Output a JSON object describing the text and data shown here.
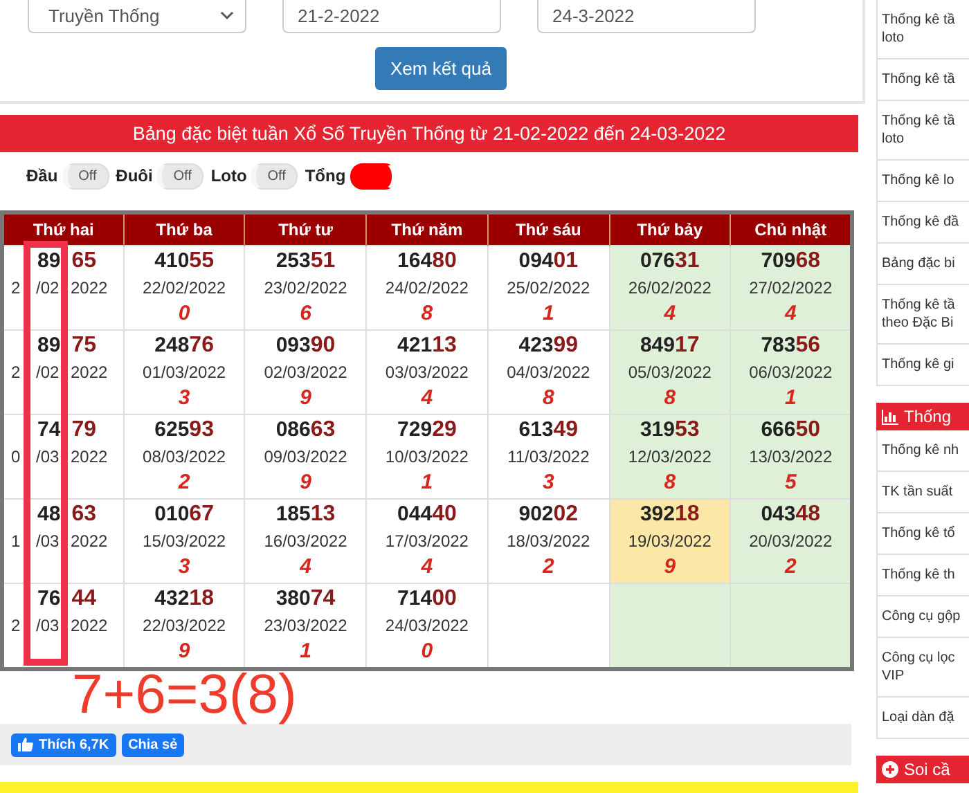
{
  "filter": {
    "province": "Truyền Thống",
    "from_date": "21-2-2022",
    "to_date": "24-3-2022",
    "submit": "Xem kết quả"
  },
  "banner": "Bảng đặc biệt tuần Xổ Số Truyền Thống từ 21-02-2022 đến 24-03-2022",
  "toggles": [
    {
      "label": "Đầu",
      "on": false,
      "state_text": "Off"
    },
    {
      "label": "Đuôi",
      "on": false,
      "state_text": "Off"
    },
    {
      "label": "Loto",
      "on": false,
      "state_text": "Off"
    },
    {
      "label": "Tổng",
      "on": true
    }
  ],
  "table": {
    "columns": [
      "Thứ hai",
      "Thứ ba",
      "Thứ tư",
      "Thứ năm",
      "Thứ sáu",
      "Thứ bảy",
      "Chủ nhật"
    ],
    "rows": [
      [
        {
          "kind": "covered",
          "head": "89",
          "tail": "65",
          "date_parts": [
            "2",
            "/02",
            "2022"
          ]
        },
        {
          "kind": "result",
          "head": "410",
          "tail": "55",
          "date": "22/02/2022",
          "sum": "0"
        },
        {
          "kind": "result",
          "head": "253",
          "tail": "51",
          "date": "23/02/2022",
          "sum": "6"
        },
        {
          "kind": "result",
          "head": "164",
          "tail": "80",
          "date": "24/02/2022",
          "sum": "8"
        },
        {
          "kind": "result",
          "head": "094",
          "tail": "01",
          "date": "25/02/2022",
          "sum": "1"
        },
        {
          "kind": "result",
          "head": "076",
          "tail": "31",
          "date": "26/02/2022",
          "sum": "4",
          "color": "#dff0d8"
        },
        {
          "kind": "result",
          "head": "709",
          "tail": "68",
          "date": "27/02/2022",
          "sum": "4",
          "color": "#dff0d8"
        }
      ],
      [
        {
          "kind": "covered",
          "head": "89",
          "tail": "75",
          "date_parts": [
            "2",
            "/02",
            "2022"
          ]
        },
        {
          "kind": "result",
          "head": "248",
          "tail": "76",
          "date": "01/03/2022",
          "sum": "3"
        },
        {
          "kind": "result",
          "head": "093",
          "tail": "90",
          "date": "02/03/2022",
          "sum": "9"
        },
        {
          "kind": "result",
          "head": "421",
          "tail": "13",
          "date": "03/03/2022",
          "sum": "4"
        },
        {
          "kind": "result",
          "head": "423",
          "tail": "99",
          "date": "04/03/2022",
          "sum": "8"
        },
        {
          "kind": "result",
          "head": "849",
          "tail": "17",
          "date": "05/03/2022",
          "sum": "8",
          "color": "#dff0d8"
        },
        {
          "kind": "result",
          "head": "783",
          "tail": "56",
          "date": "06/03/2022",
          "sum": "1",
          "color": "#dff0d8"
        }
      ],
      [
        {
          "kind": "covered",
          "head": "74",
          "tail": "79",
          "date_parts": [
            "0",
            "/03",
            "2022"
          ]
        },
        {
          "kind": "result",
          "head": "625",
          "tail": "93",
          "date": "08/03/2022",
          "sum": "2"
        },
        {
          "kind": "result",
          "head": "086",
          "tail": "63",
          "date": "09/03/2022",
          "sum": "9"
        },
        {
          "kind": "result",
          "head": "729",
          "tail": "29",
          "date": "10/03/2022",
          "sum": "1"
        },
        {
          "kind": "result",
          "head": "613",
          "tail": "49",
          "date": "11/03/2022",
          "sum": "3"
        },
        {
          "kind": "result",
          "head": "319",
          "tail": "53",
          "date": "12/03/2022",
          "sum": "8",
          "color": "#dff0d8"
        },
        {
          "kind": "result",
          "head": "666",
          "tail": "50",
          "date": "13/03/2022",
          "sum": "5",
          "color": "#dff0d8"
        }
      ],
      [
        {
          "kind": "covered",
          "head": "48",
          "tail": "63",
          "date_parts": [
            "1",
            "/03",
            "2022"
          ]
        },
        {
          "kind": "result",
          "head": "010",
          "tail": "67",
          "date": "15/03/2022",
          "sum": "3"
        },
        {
          "kind": "result",
          "head": "185",
          "tail": "13",
          "date": "16/03/2022",
          "sum": "4"
        },
        {
          "kind": "result",
          "head": "044",
          "tail": "40",
          "date": "17/03/2022",
          "sum": "4"
        },
        {
          "kind": "result",
          "head": "902",
          "tail": "02",
          "date": "18/03/2022",
          "sum": "2"
        },
        {
          "kind": "result",
          "head": "392",
          "tail": "18",
          "date": "19/03/2022",
          "sum": "9",
          "color": "#fce8a6"
        },
        {
          "kind": "result",
          "head": "043",
          "tail": "48",
          "date": "20/03/2022",
          "sum": "2",
          "color": "#dff0d8"
        }
      ],
      [
        {
          "kind": "covered",
          "head": "76",
          "tail": "44",
          "date_parts": [
            "2",
            "/03",
            "2022"
          ]
        },
        {
          "kind": "result",
          "head": "432",
          "tail": "18",
          "date": "22/03/2022",
          "sum": "9"
        },
        {
          "kind": "result",
          "head": "380",
          "tail": "74",
          "date": "23/03/2022",
          "sum": "1"
        },
        {
          "kind": "result",
          "head": "714",
          "tail": "00",
          "date": "24/03/2022",
          "sum": "0"
        },
        {
          "kind": "empty"
        },
        {
          "kind": "empty",
          "color": "#dff0d8"
        },
        {
          "kind": "empty",
          "color": "#dff0d8"
        }
      ]
    ]
  },
  "annotation": "7+6=3(8)",
  "social": {
    "like": "Thích",
    "like_count": "6,7K",
    "share": "Chia sẻ"
  },
  "sidebar": {
    "items": [
      "Thống kê tầ\nloto",
      "Thống kê tầ",
      "Thống kê tầ\nloto",
      "Thống kê lo",
      "Thống kê đầ",
      "Bảng đặc bi",
      "Thống kê tầ\ntheo Đặc Bi",
      "Thống kê gi"
    ],
    "section_title": "Thống",
    "section_items": [
      "Thống kê nh",
      "TK tần suất",
      "Thống kê tổ",
      "Thống kê th",
      "Công cụ gộp",
      "Công cụ lọc\nVIP",
      "Loại dàn đặ"
    ],
    "next_section_title": "Soi cầ"
  }
}
